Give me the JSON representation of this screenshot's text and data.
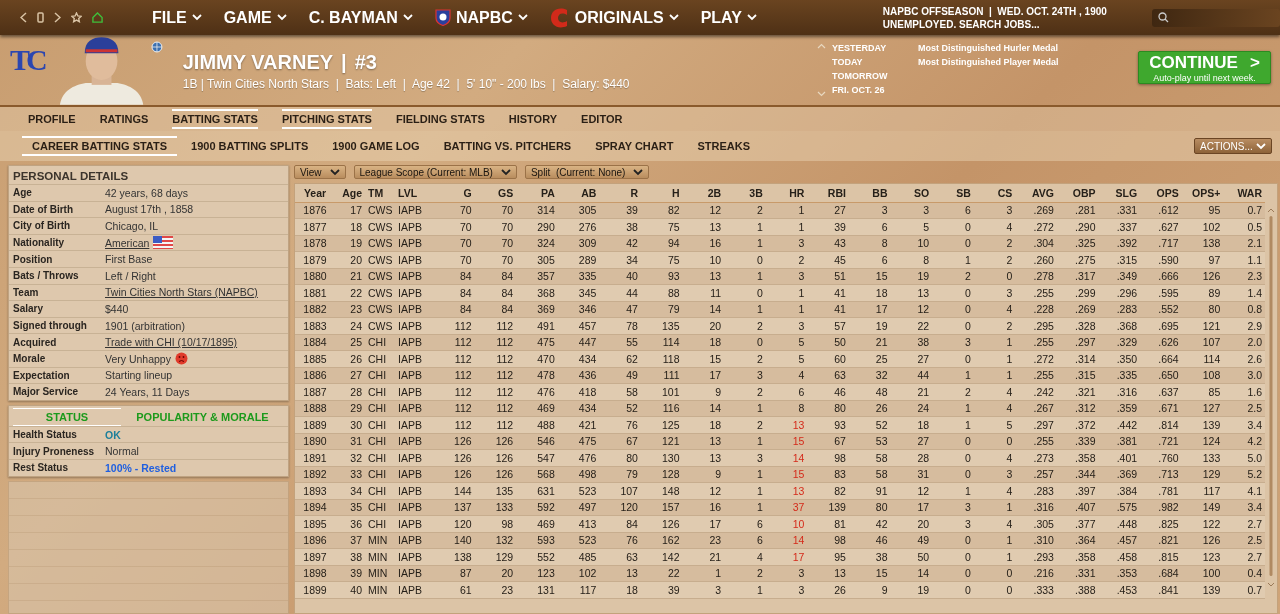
{
  "top_bar": {
    "menus": [
      {
        "label": "FILE"
      },
      {
        "label": "GAME"
      },
      {
        "label": "C. BAYMAN"
      },
      {
        "label": "NAPBC"
      },
      {
        "label": "ORIGINALS"
      },
      {
        "label": "PLAY"
      }
    ],
    "league_status": "NAPBC OFFSEASON  |  WED. OCT. 24TH , 1900",
    "job_status": "UNEMPLOYED. SEARCH JOBS..."
  },
  "player": {
    "team_logo": "TC",
    "name": "JIMMY VARNEY",
    "separator": "|",
    "number": "#3",
    "summary": "1B | Twin Cities North Stars  |  Bats: Left  |  Age 42  |  5' 10\" - 200 lbs  |  Salary: $440"
  },
  "calendar": [
    {
      "day": "YESTERDAY",
      "event": "Most Distinguished Hurler Medal"
    },
    {
      "day": "TODAY",
      "event": "Most Distinguished Player Medal"
    },
    {
      "day": "TOMORROW"
    },
    {
      "day": "FRI. OCT. 26"
    }
  ],
  "continue_button": {
    "label": "CONTINUE",
    "sublabel": "Auto-play until next week.",
    "chevron": ">"
  },
  "tabs": [
    {
      "label": "PROFILE",
      "selected": false
    },
    {
      "label": "RATINGS",
      "selected": false
    },
    {
      "label": "BATTING STATS",
      "selected": true
    },
    {
      "label": "PITCHING STATS",
      "selected": true
    },
    {
      "label": "FIELDING STATS",
      "selected": false
    },
    {
      "label": "HISTORY",
      "selected": false
    },
    {
      "label": "EDITOR",
      "selected": false
    }
  ],
  "sub_tabs": [
    {
      "label": "CAREER BATTING STATS",
      "selected": true
    },
    {
      "label": "1900 BATTING SPLITS",
      "selected": false
    },
    {
      "label": "1900 GAME LOG",
      "selected": false
    },
    {
      "label": "BATTING VS. PITCHERS",
      "selected": false
    },
    {
      "label": "SPRAY CHART",
      "selected": false
    },
    {
      "label": "STREAKS",
      "selected": false
    }
  ],
  "actions_button": "ACTIONS...",
  "personal_details": {
    "title": "PERSONAL DETAILS",
    "rows": [
      {
        "label": "Age",
        "value": "42 years, 68 days",
        "link": false
      },
      {
        "label": "Date of Birth",
        "value": "August 17th , 1858",
        "link": false
      },
      {
        "label": "City of Birth",
        "value": "Chicago, IL",
        "link": false
      },
      {
        "label": "Nationality",
        "value": "American",
        "link": true
      },
      {
        "label": "Position",
        "value": "First Base",
        "link": false
      },
      {
        "label": "Bats / Throws",
        "value": "Left / Right",
        "link": false
      },
      {
        "label": "Team",
        "value": "Twin Cities North Stars (NAPBC)",
        "link": true
      },
      {
        "label": "Salary",
        "value": "$440",
        "link": false
      },
      {
        "label": "Signed through",
        "value": "1901 (arbitration)",
        "link": false
      },
      {
        "label": "Acquired",
        "value": "Trade with CHI (10/17/1895)",
        "link": true
      },
      {
        "label": "Morale",
        "value": "Very Unhappy",
        "link": false
      },
      {
        "label": "Expectation",
        "value": "Starting lineup",
        "link": false
      },
      {
        "label": "Major Service",
        "value": "24 Years, 11 Days",
        "link": false
      }
    ]
  },
  "status_panel": {
    "tabs": [
      {
        "label": "STATUS",
        "selected": true
      },
      {
        "label": "POPULARITY & MORALE",
        "selected": false
      }
    ],
    "rows": [
      {
        "label": "Health Status",
        "value": "OK",
        "color": "#1d7f9a"
      },
      {
        "label": "Injury Proneness",
        "value": "Normal",
        "color": "#333333"
      },
      {
        "label": "Rest Status",
        "value": "100% - Rested",
        "color": "#1f5fe0"
      }
    ]
  },
  "filters": [
    "View",
    "League Scope (Current: MLB)",
    "Split  (Current: None)"
  ],
  "table": {
    "columns": [
      "Year",
      "Age",
      "TM",
      "LVL",
      "G",
      "GS",
      "PA",
      "AB",
      "R",
      "H",
      "2B",
      "3B",
      "HR",
      "RBI",
      "BB",
      "SO",
      "SB",
      "CS",
      "AVG",
      "OBP",
      "SLG",
      "OPS",
      "OPS+",
      "WAR"
    ],
    "rows": [
      {
        "cells": [
          "1876",
          "17",
          "CWS",
          "IAPB",
          "70",
          "70",
          "314",
          "305",
          "39",
          "82",
          "12",
          "2",
          "1",
          "27",
          "3",
          "3",
          "6",
          "3",
          ".269",
          ".281",
          ".331",
          ".612",
          "95",
          "0.7"
        ],
        "hr_leader": false
      },
      {
        "cells": [
          "1877",
          "18",
          "CWS",
          "IAPB",
          "70",
          "70",
          "290",
          "276",
          "38",
          "75",
          "13",
          "1",
          "1",
          "39",
          "6",
          "5",
          "0",
          "4",
          ".272",
          ".290",
          ".337",
          ".627",
          "102",
          "0.5"
        ],
        "hr_leader": false
      },
      {
        "cells": [
          "1878",
          "19",
          "CWS",
          "IAPB",
          "70",
          "70",
          "324",
          "309",
          "42",
          "94",
          "16",
          "1",
          "3",
          "43",
          "8",
          "10",
          "0",
          "2",
          ".304",
          ".325",
          ".392",
          ".717",
          "138",
          "2.1"
        ],
        "hr_leader": false
      },
      {
        "cells": [
          "1879",
          "20",
          "CWS",
          "IAPB",
          "70",
          "70",
          "305",
          "289",
          "34",
          "75",
          "10",
          "0",
          "2",
          "45",
          "6",
          "8",
          "1",
          "2",
          ".260",
          ".275",
          ".315",
          ".590",
          "97",
          "1.1"
        ],
        "hr_leader": false
      },
      {
        "cells": [
          "1880",
          "21",
          "CWS",
          "IAPB",
          "84",
          "84",
          "357",
          "335",
          "40",
          "93",
          "13",
          "1",
          "3",
          "51",
          "15",
          "19",
          "2",
          "0",
          ".278",
          ".317",
          ".349",
          ".666",
          "126",
          "2.3"
        ],
        "hr_leader": false
      },
      {
        "cells": [
          "1881",
          "22",
          "CWS",
          "IAPB",
          "84",
          "84",
          "368",
          "345",
          "44",
          "88",
          "11",
          "0",
          "1",
          "41",
          "18",
          "13",
          "0",
          "3",
          ".255",
          ".299",
          ".296",
          ".595",
          "89",
          "1.4"
        ],
        "hr_leader": false
      },
      {
        "cells": [
          "1882",
          "23",
          "CWS",
          "IAPB",
          "84",
          "84",
          "369",
          "346",
          "47",
          "79",
          "14",
          "1",
          "1",
          "41",
          "17",
          "12",
          "0",
          "4",
          ".228",
          ".269",
          ".283",
          ".552",
          "80",
          "0.8"
        ],
        "hr_leader": false
      },
      {
        "cells": [
          "1883",
          "24",
          "CWS",
          "IAPB",
          "112",
          "112",
          "491",
          "457",
          "78",
          "135",
          "20",
          "2",
          "3",
          "57",
          "19",
          "22",
          "0",
          "2",
          ".295",
          ".328",
          ".368",
          ".695",
          "121",
          "2.9"
        ],
        "hr_leader": false
      },
      {
        "cells": [
          "1884",
          "25",
          "CHI",
          "IAPB",
          "112",
          "112",
          "475",
          "447",
          "55",
          "114",
          "18",
          "0",
          "5",
          "50",
          "21",
          "38",
          "3",
          "1",
          ".255",
          ".297",
          ".329",
          ".626",
          "107",
          "2.0"
        ],
        "hr_leader": false
      },
      {
        "cells": [
          "1885",
          "26",
          "CHI",
          "IAPB",
          "112",
          "112",
          "470",
          "434",
          "62",
          "118",
          "15",
          "2",
          "5",
          "60",
          "25",
          "27",
          "0",
          "1",
          ".272",
          ".314",
          ".350",
          ".664",
          "114",
          "2.6"
        ],
        "hr_leader": false
      },
      {
        "cells": [
          "1886",
          "27",
          "CHI",
          "IAPB",
          "112",
          "112",
          "478",
          "436",
          "49",
          "111",
          "17",
          "3",
          "4",
          "63",
          "32",
          "44",
          "1",
          "1",
          ".255",
          ".315",
          ".335",
          ".650",
          "108",
          "3.0"
        ],
        "hr_leader": false
      },
      {
        "cells": [
          "1887",
          "28",
          "CHI",
          "IAPB",
          "112",
          "112",
          "476",
          "418",
          "58",
          "101",
          "9",
          "2",
          "6",
          "46",
          "48",
          "21",
          "2",
          "4",
          ".242",
          ".321",
          ".316",
          ".637",
          "85",
          "1.6"
        ],
        "hr_leader": false
      },
      {
        "cells": [
          "1888",
          "29",
          "CHI",
          "IAPB",
          "112",
          "112",
          "469",
          "434",
          "52",
          "116",
          "14",
          "1",
          "8",
          "80",
          "26",
          "24",
          "1",
          "4",
          ".267",
          ".312",
          ".359",
          ".671",
          "127",
          "2.5"
        ],
        "hr_leader": false
      },
      {
        "cells": [
          "1889",
          "30",
          "CHI",
          "IAPB",
          "112",
          "112",
          "488",
          "421",
          "76",
          "125",
          "18",
          "2",
          "13",
          "93",
          "52",
          "18",
          "1",
          "5",
          ".297",
          ".372",
          ".442",
          ".814",
          "139",
          "3.4"
        ],
        "hr_leader": true
      },
      {
        "cells": [
          "1890",
          "31",
          "CHI",
          "IAPB",
          "126",
          "126",
          "546",
          "475",
          "67",
          "121",
          "13",
          "1",
          "15",
          "67",
          "53",
          "27",
          "0",
          "0",
          ".255",
          ".339",
          ".381",
          ".721",
          "124",
          "4.2"
        ],
        "hr_leader": true
      },
      {
        "cells": [
          "1891",
          "32",
          "CHI",
          "IAPB",
          "126",
          "126",
          "547",
          "476",
          "80",
          "130",
          "13",
          "3",
          "14",
          "98",
          "58",
          "28",
          "0",
          "4",
          ".273",
          ".358",
          ".401",
          ".760",
          "133",
          "5.0"
        ],
        "hr_leader": true
      },
      {
        "cells": [
          "1892",
          "33",
          "CHI",
          "IAPB",
          "126",
          "126",
          "568",
          "498",
          "79",
          "128",
          "9",
          "1",
          "15",
          "83",
          "58",
          "31",
          "0",
          "3",
          ".257",
          ".344",
          ".369",
          ".713",
          "129",
          "5.2"
        ],
        "hr_leader": true
      },
      {
        "cells": [
          "1893",
          "34",
          "CHI",
          "IAPB",
          "144",
          "135",
          "631",
          "523",
          "107",
          "148",
          "12",
          "1",
          "13",
          "82",
          "91",
          "12",
          "1",
          "4",
          ".283",
          ".397",
          ".384",
          ".781",
          "117",
          "4.1"
        ],
        "hr_leader": true
      },
      {
        "cells": [
          "1894",
          "35",
          "CHI",
          "IAPB",
          "137",
          "133",
          "592",
          "497",
          "120",
          "157",
          "16",
          "1",
          "37",
          "139",
          "80",
          "17",
          "3",
          "1",
          ".316",
          ".407",
          ".575",
          ".982",
          "149",
          "3.4"
        ],
        "hr_leader": true
      },
      {
        "cells": [
          "1895",
          "36",
          "CHI",
          "IAPB",
          "120",
          "98",
          "469",
          "413",
          "84",
          "126",
          "17",
          "6",
          "10",
          "81",
          "42",
          "20",
          "3",
          "4",
          ".305",
          ".377",
          ".448",
          ".825",
          "122",
          "2.7"
        ],
        "hr_leader": true
      },
      {
        "cells": [
          "1896",
          "37",
          "MIN",
          "IAPB",
          "140",
          "132",
          "593",
          "523",
          "76",
          "162",
          "23",
          "6",
          "14",
          "98",
          "46",
          "49",
          "0",
          "1",
          ".310",
          ".364",
          ".457",
          ".821",
          "126",
          "2.5"
        ],
        "hr_leader": true
      },
      {
        "cells": [
          "1897",
          "38",
          "MIN",
          "IAPB",
          "138",
          "129",
          "552",
          "485",
          "63",
          "142",
          "21",
          "4",
          "17",
          "95",
          "38",
          "50",
          "0",
          "1",
          ".293",
          ".358",
          ".458",
          ".815",
          "123",
          "2.7"
        ],
        "hr_leader": true
      },
      {
        "cells": [
          "1898",
          "39",
          "MIN",
          "IAPB",
          "87",
          "20",
          "123",
          "102",
          "13",
          "22",
          "1",
          "2",
          "3",
          "13",
          "15",
          "14",
          "0",
          "0",
          ".216",
          ".331",
          ".353",
          ".684",
          "100",
          "0.4"
        ],
        "hr_leader": false
      },
      {
        "cells": [
          "1899",
          "40",
          "MIN",
          "IAPB",
          "61",
          "23",
          "131",
          "117",
          "18",
          "39",
          "3",
          "1",
          "3",
          "26",
          "9",
          "19",
          "0",
          "0",
          ".333",
          ".388",
          ".453",
          ".841",
          "139",
          "0.7"
        ],
        "hr_leader": false
      }
    ]
  }
}
